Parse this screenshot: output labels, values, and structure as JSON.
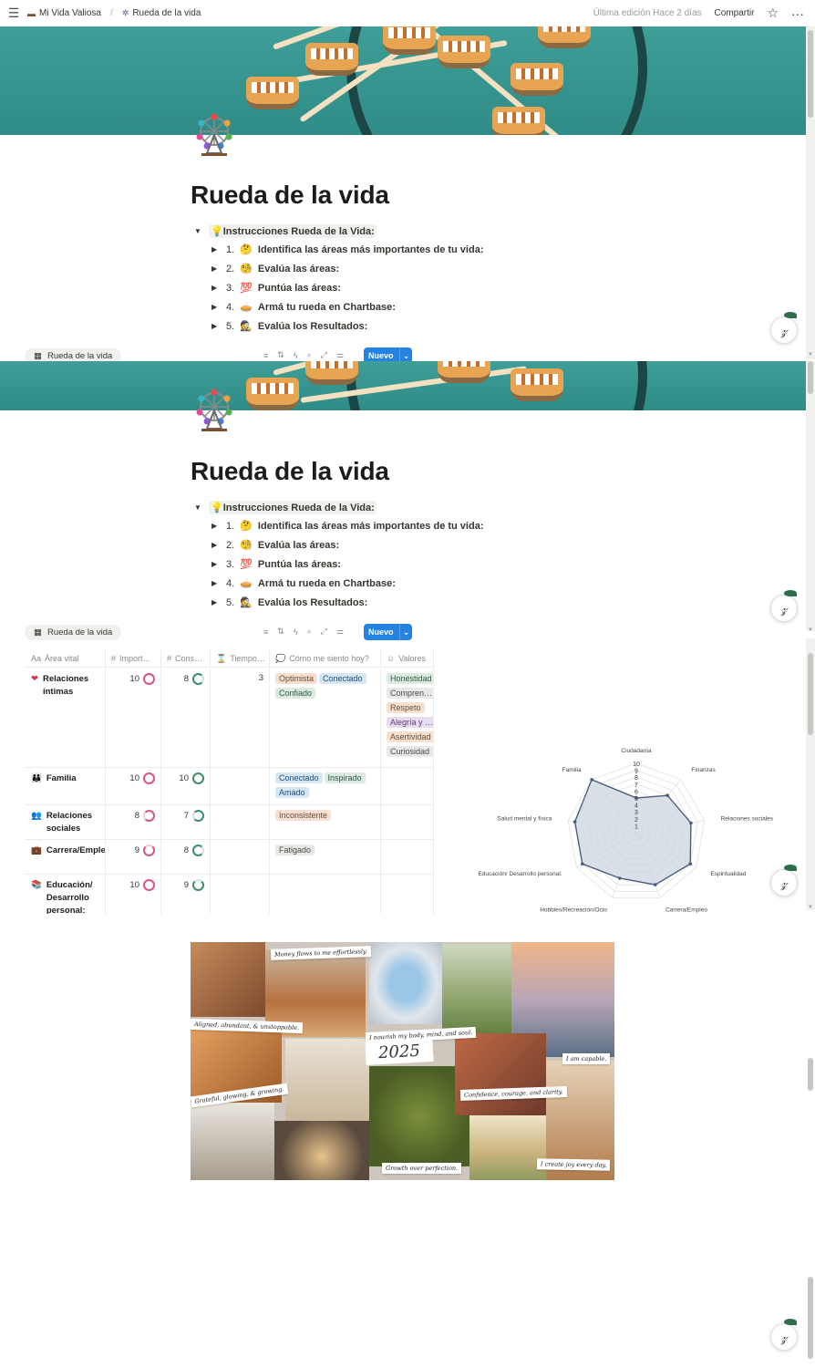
{
  "topbar": {
    "workspace": "Mi Vida Valiosa",
    "page": "Rueda de la vida",
    "edited": "Última edición Hace 2 días",
    "share": "Compartir",
    "icons": [
      "menu-icon",
      "star-icon",
      "more-icon"
    ]
  },
  "page": {
    "title": "Rueda de la vida",
    "instructions_title": "Instrucciones Rueda de la Vida:",
    "steps": [
      {
        "num": "1.",
        "label": "Identifica las áreas más importantes de tu vida:"
      },
      {
        "num": "2.",
        "label": "Evalúa las áreas:"
      },
      {
        "num": "3.",
        "label": "Puntúa las áreas:"
      },
      {
        "num": "4.",
        "label": "Armá tu rueda en Chartbase:"
      },
      {
        "num": "5.",
        "label": "Evalúa los Resultados:"
      }
    ]
  },
  "database": {
    "view_tab": "Rueda de la vida",
    "new_button": "Nuevo",
    "columns": [
      "Área vital",
      "Import…",
      "Cons…",
      "Tiempo…",
      "Cómo me siento hoy?",
      "Valores"
    ],
    "rows": [
      {
        "area": "Relaciones íntimas",
        "importancia": "10",
        "consistencia": "8",
        "tiempo": "3",
        "feel": [
          {
            "t": "Optimista",
            "c": "orange"
          },
          {
            "t": "Conectado",
            "c": "blue"
          },
          {
            "t": "Confiado",
            "c": "green"
          }
        ],
        "valores": [
          {
            "t": "Honestidad",
            "c": "green"
          },
          {
            "t": "Compren…",
            "c": "gray"
          },
          {
            "t": "Respeto",
            "c": "orange"
          },
          {
            "t": "Alegría y …",
            "c": "purple"
          },
          {
            "t": "Asertividad",
            "c": "orange"
          },
          {
            "t": "Curiosidad",
            "c": "gray"
          }
        ]
      },
      {
        "area": "Familia",
        "importancia": "10",
        "consistencia": "10",
        "tiempo": "",
        "feel": [
          {
            "t": "Conectado",
            "c": "blue"
          },
          {
            "t": "Inspirado",
            "c": "green"
          },
          {
            "t": "Amado",
            "c": "blue"
          }
        ],
        "valores": []
      },
      {
        "area": "Relaciones sociales",
        "importancia": "8",
        "consistencia": "7",
        "tiempo": "",
        "feel": [
          {
            "t": "Inconsistente",
            "c": "orange"
          }
        ],
        "valores": []
      },
      {
        "area": "Carrera/Empleo",
        "importancia": "9",
        "consistencia": "8",
        "tiempo": "",
        "feel": [
          {
            "t": "Fatigado",
            "c": "gray"
          }
        ],
        "valores": []
      },
      {
        "area": "Educación/ Desarrollo personal:",
        "importancia": "10",
        "consistencia": "9",
        "tiempo": "",
        "feel": [],
        "valores": []
      }
    ]
  },
  "chart_data": {
    "type": "radar",
    "categories": [
      "Ciudadanía",
      "Finanzas",
      "Relaciones sociales",
      "Espiritualidad",
      "Carrera/Empleo",
      "Hobbies/Recreación/Ocio",
      "Educación/ Desarrollo personal:",
      "Salud mental y física",
      "Familia"
    ],
    "series": [
      {
        "values": [
          5,
          7,
          8,
          9,
          8,
          7,
          9,
          9,
          10
        ]
      }
    ],
    "rlim": [
      0,
      10
    ],
    "ticks": [
      "1",
      "2",
      "3",
      "4",
      "5",
      "6",
      "7",
      "8",
      "9",
      "10"
    ],
    "fill": "#cdd5e0",
    "stroke": "#4a5f7f"
  },
  "collage": {
    "year": "2025",
    "notes": [
      "Money flows to me effortlessly.",
      "Aligned, abundant, & unstoppable.",
      "I nourish my body, mind, and soul.",
      "I am capable.",
      "Grateful, glowing, & growing.",
      "Confidence, courage, and clarity.",
      "Growth over perfection.",
      "I create joy every day."
    ]
  }
}
